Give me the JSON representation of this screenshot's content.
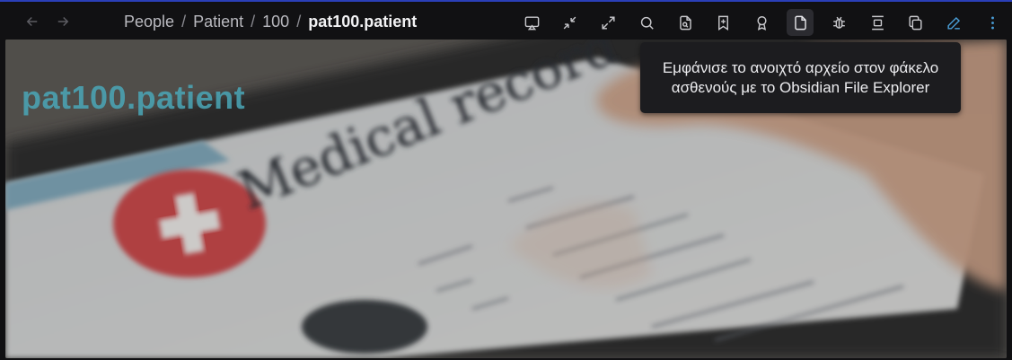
{
  "breadcrumb": {
    "items": [
      "People",
      "Patient",
      "100"
    ],
    "separator": "/",
    "current": "pat100.patient"
  },
  "banner": {
    "title": "pat100.patient",
    "image_text": "Medical record"
  },
  "tooltip": {
    "text": "Εμφάνισε το ανοιχτό αρχείο στον φάκελο ασθενούς με το Obsidian File Explorer"
  },
  "toolbar": {
    "icons": [
      "cast-icon",
      "collapse-icon",
      "expand-icon",
      "search-icon",
      "file-search-icon",
      "bookmark-plus-icon",
      "badge-icon",
      "file-icon",
      "bug-icon",
      "align-center-icon",
      "copy-icon",
      "pencil-icon",
      "more-vertical-icon"
    ],
    "active_icon": "file-icon",
    "accent_color": "#4a9fd8"
  }
}
